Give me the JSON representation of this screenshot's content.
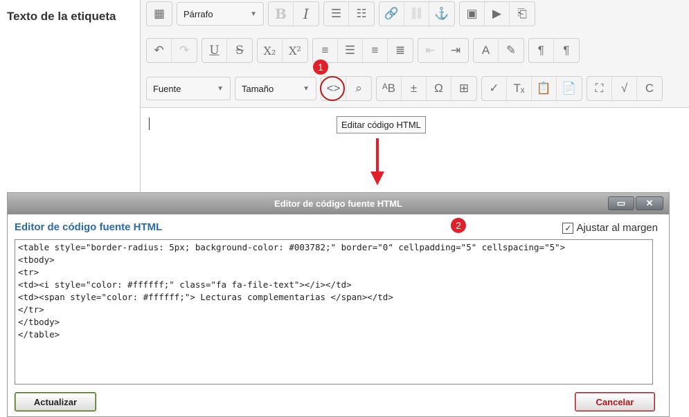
{
  "field_label": "Texto de la etiqueta",
  "toolbar": {
    "paragraph_select": "Párrafo",
    "font_select": "Fuente",
    "size_select": "Tamaño",
    "row1": [
      {
        "name": "toolbar-toggle-icon",
        "glyph": "▦",
        "dis": false
      },
      {
        "name": "bold-icon",
        "glyph": "B",
        "cls": "b",
        "dis": true
      },
      {
        "name": "italic-icon",
        "glyph": "I",
        "cls": "i",
        "dis": false
      },
      {
        "name": "bullet-list-icon",
        "glyph": "☰",
        "dis": false
      },
      {
        "name": "numbered-list-icon",
        "glyph": "☷",
        "dis": false
      },
      {
        "name": "link-icon",
        "glyph": "🔗",
        "dis": true
      },
      {
        "name": "unlink-icon",
        "glyph": "⛓",
        "dis": true
      },
      {
        "name": "anchor-icon",
        "glyph": "⚓",
        "dis": true
      },
      {
        "name": "image-icon",
        "glyph": "▣",
        "dis": false
      },
      {
        "name": "media-icon",
        "glyph": "▶",
        "dis": false
      },
      {
        "name": "file-icon",
        "glyph": "⎗",
        "dis": false
      }
    ],
    "row2": [
      {
        "name": "undo-icon",
        "glyph": "↶",
        "dis": false
      },
      {
        "name": "redo-icon",
        "glyph": "↷",
        "dis": true
      },
      {
        "name": "underline-icon",
        "glyph": "U",
        "cls": "u",
        "dis": false
      },
      {
        "name": "strikethrough-icon",
        "glyph": "S",
        "cls": "s",
        "dis": false
      },
      {
        "name": "subscript-icon",
        "glyph": "X₂",
        "cls": "sub",
        "dis": false
      },
      {
        "name": "superscript-icon",
        "glyph": "X²",
        "cls": "sup",
        "dis": false
      },
      {
        "name": "align-left-icon",
        "glyph": "≡",
        "dis": false
      },
      {
        "name": "align-center-icon",
        "glyph": "☰",
        "dis": false
      },
      {
        "name": "align-right-icon",
        "glyph": "≡",
        "dis": false
      },
      {
        "name": "justify-icon",
        "glyph": "≣",
        "dis": false
      },
      {
        "name": "outdent-icon",
        "glyph": "⇤",
        "dis": true
      },
      {
        "name": "indent-icon",
        "glyph": "⇥",
        "dis": false
      },
      {
        "name": "text-color-icon",
        "glyph": "A",
        "dis": false
      },
      {
        "name": "background-color-icon",
        "glyph": "✎",
        "dis": false
      },
      {
        "name": "ltr-icon",
        "glyph": "¶",
        "dis": false
      },
      {
        "name": "rtl-icon",
        "glyph": "¶",
        "dis": false
      }
    ],
    "row3": [
      {
        "name": "html-code-icon",
        "glyph": "<>",
        "dis": false
      },
      {
        "name": "find-replace-icon",
        "glyph": "⌕",
        "dis": false
      },
      {
        "name": "case-icon",
        "glyph": "ᴬB",
        "dis": false
      },
      {
        "name": "insert-icon",
        "glyph": "±",
        "dis": false
      },
      {
        "name": "special-char-icon",
        "glyph": "Ω",
        "dis": false
      },
      {
        "name": "table-icon",
        "glyph": "⊞",
        "dis": false
      },
      {
        "name": "clear-format-icon",
        "glyph": "✓",
        "dis": false
      },
      {
        "name": "remove-format-icon",
        "glyph": "Tₓ",
        "dis": false
      },
      {
        "name": "paste-text-icon",
        "glyph": "📋",
        "dis": false
      },
      {
        "name": "paste-word-icon",
        "glyph": "📄",
        "dis": false
      },
      {
        "name": "fullscreen-icon",
        "glyph": "⛶",
        "dis": false
      },
      {
        "name": "equation-icon",
        "glyph": "√",
        "dis": false
      },
      {
        "name": "spellcheck-icon",
        "glyph": "C",
        "dis": false
      }
    ]
  },
  "tooltip": "Editar código HTML",
  "markers": [
    "1",
    "2"
  ],
  "dialog": {
    "title": "Editor de código fuente HTML",
    "heading": "Editor de código fuente HTML",
    "wrap_label": "Ajustar al margen",
    "wrap_checked": true,
    "code": "<table style=\"border-radius: 5px; background-color: #003782;\" border=\"0\" cellpadding=\"5\" cellspacing=\"5\">\n<tbody>\n<tr>\n<td><i style=\"color: #ffffff;\" class=\"fa fa-file-text\"></i></td>\n<td><span style=\"color: #ffffff;\"> Lecturas complementarias </span></td>\n</tr>\n</tbody>\n</table>",
    "update_label": "Actualizar",
    "cancel_label": "Cancelar"
  },
  "colors": {
    "accent_red": "#e0202a",
    "heading_blue": "#2a6aa8"
  }
}
